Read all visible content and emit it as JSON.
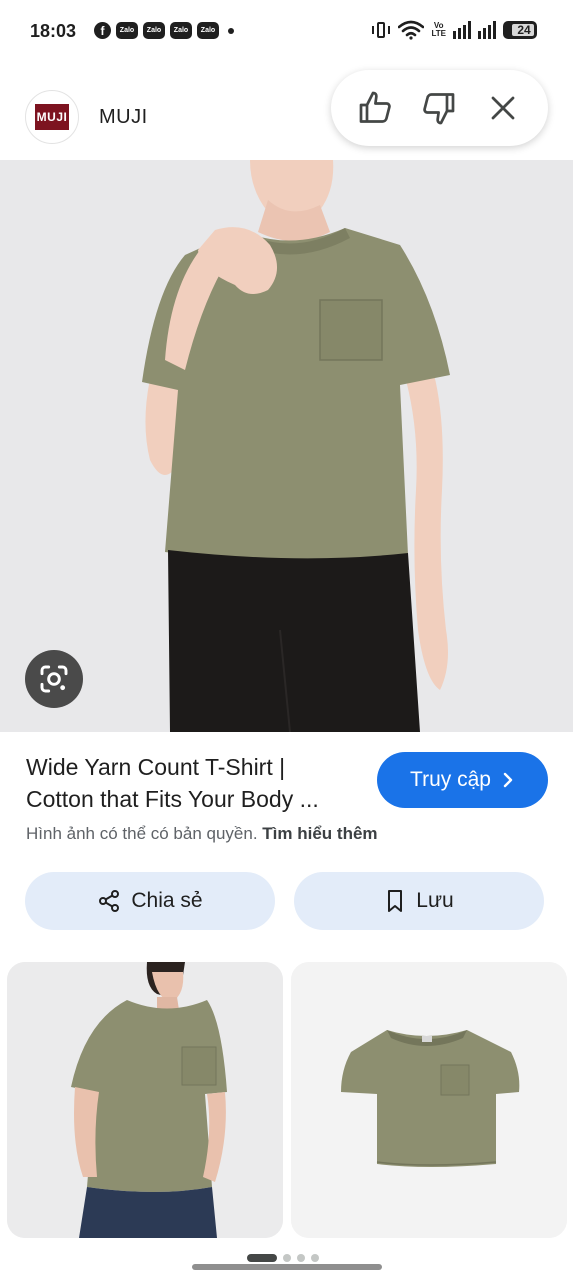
{
  "status_bar": {
    "time": "18:03",
    "notification_icons": [
      "facebook-icon",
      "zalo-icon",
      "zalo-icon",
      "zalo-icon",
      "zalo-icon",
      "dot-icon"
    ],
    "zalo_label": "Zalo",
    "facebook_label": "f",
    "volte_line1": "Vo",
    "volte_line2": "LTE",
    "battery_level": "24"
  },
  "header": {
    "brand_logo_text": "MUJI",
    "brand_name": "MUJI",
    "feedback": {
      "like_icon": "thumbs-up-icon",
      "dislike_icon": "thumbs-down-icon",
      "close_icon": "close-icon"
    }
  },
  "hero": {
    "lens_icon": "google-lens-icon"
  },
  "result": {
    "title_line1": "Wide Yarn Count T-Shirt |",
    "title_line2": "Cotton that Fits Your Body ...",
    "visit_label": "Truy cập",
    "copyright_text": "Hình ảnh có thể có bản quyền.",
    "learn_more": "Tìm hiểu thêm"
  },
  "actions": {
    "share_label": "Chia sẻ",
    "save_label": "Lưu"
  },
  "carousel": {
    "page_count": 4,
    "active_page": 1
  },
  "colors": {
    "accent": "#1a73e8",
    "action_button_bg": "#e3ecf9",
    "shirt": "#8d8f70",
    "brand": "#7d1320"
  }
}
